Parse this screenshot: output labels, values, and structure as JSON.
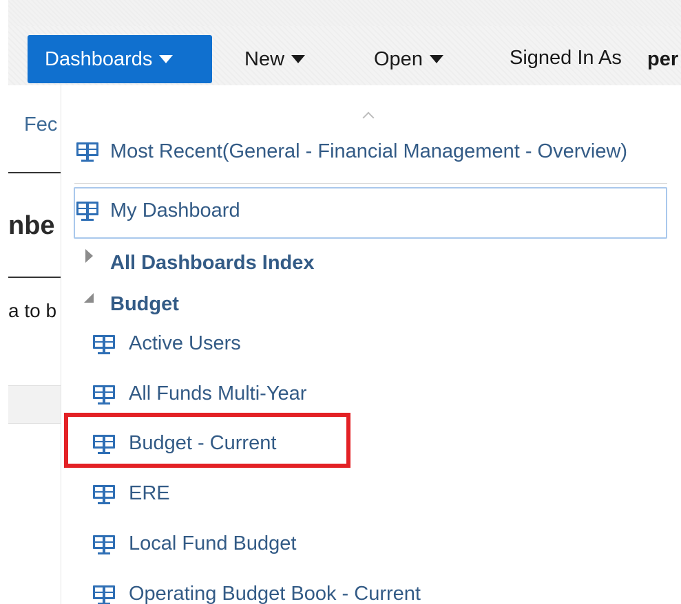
{
  "header": {
    "dashboards_label": "Dashboards",
    "new_label": "New",
    "open_label": "Open",
    "signed_in_label": "Signed In As",
    "signed_in_user": "per"
  },
  "background_page": {
    "tab_text": "Fec",
    "title_fragment": "nbe",
    "text_fragment": "a to b"
  },
  "dropdown": {
    "most_recent": "Most Recent(General - Financial Management - Overview)",
    "my_dashboard": "My Dashboard",
    "all_index": "All Dashboards Index",
    "budget_folder": "Budget",
    "budget_items": [
      "Active Users",
      "All Funds Multi-Year",
      "Budget - Current",
      "ERE",
      "Local Fund Budget",
      "Operating Budget Book - Current"
    ],
    "icon": "dashboard-monitor-icon",
    "highlight_color": "#e32125",
    "accent_color": "#1070cf",
    "link_color": "#335b86"
  }
}
